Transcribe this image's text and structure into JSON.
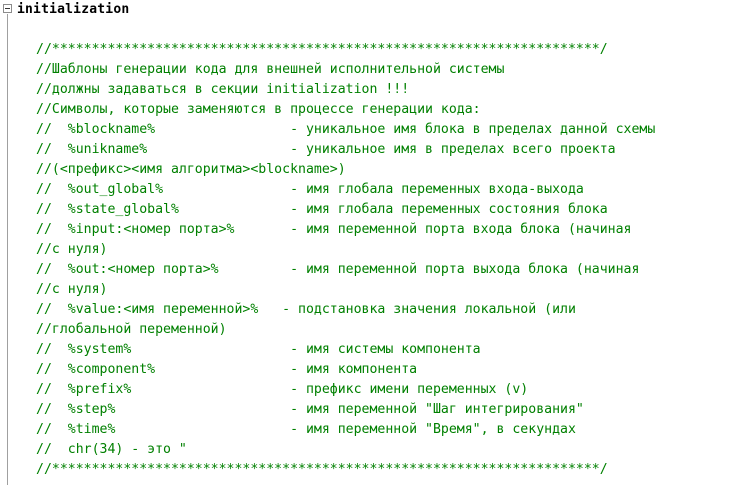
{
  "section": {
    "title": "initialization"
  },
  "code": {
    "lines": [
      "//*********************************************************************/",
      "//Шаблоны генерации кода для внешней исполнительной системы",
      "//должны задаваться в секции initialization !!!",
      "//Символы, которые заменяются в процессе генерации кода:",
      "//  %blockname%                 - уникальное имя блока в пределах данной схемы",
      "//  %unikname%                  - уникальное имя в пределах всего проекта",
      "//(<префикс><имя алгоритма><blockname>)",
      "//  %out_global%                - имя глобала переменных входа-выхода",
      "//  %state_global%              - имя глобала переменных состояния блока",
      "//  %input:<номер порта>%       - имя переменной порта входа блока (начиная",
      "//с нуля)",
      "//  %out:<номер порта>%         - имя переменной порта выхода блока (начиная",
      "//с нуля)",
      "//  %value:<имя переменной>%   - подстановка значения локальной (или",
      "//глобальной переменной)",
      "//  %system%                    - имя системы компонента",
      "//  %component%                 - имя компонента",
      "//  %prefix%                    - префикс имени переменных (v)",
      "//  %step%                      - имя переменной \"Шаг интегрирования\"",
      "//  %time%                      - имя переменной \"Время\", в секундах",
      "//  chr(34) - это \"",
      "//*********************************************************************/"
    ]
  },
  "colors": {
    "comment": "#008000",
    "keyword": "#000000",
    "background": "#ffffff"
  }
}
